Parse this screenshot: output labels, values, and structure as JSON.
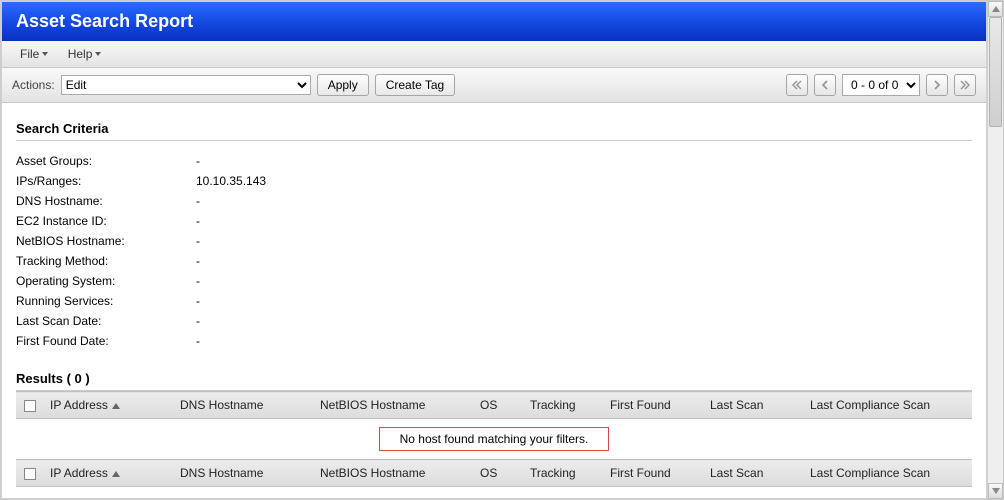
{
  "header": {
    "title": "Asset Search Report"
  },
  "menubar": {
    "file": "File",
    "help": "Help"
  },
  "toolbar": {
    "actions_label": "Actions:",
    "actions_value": "Edit",
    "apply_label": "Apply",
    "create_tag_label": "Create Tag",
    "pager_value": "0 - 0 of 0"
  },
  "criteria": {
    "title": "Search Criteria",
    "rows": [
      {
        "k": "Asset Groups:",
        "v": "-"
      },
      {
        "k": "IPs/Ranges:",
        "v": "10.10.35.143"
      },
      {
        "k": "DNS Hostname:",
        "v": "-"
      },
      {
        "k": "EC2 Instance ID:",
        "v": "-"
      },
      {
        "k": "NetBIOS Hostname:",
        "v": "-"
      },
      {
        "k": "Tracking Method:",
        "v": "-"
      },
      {
        "k": "Operating System:",
        "v": "-"
      },
      {
        "k": "Running Services:",
        "v": "-"
      },
      {
        "k": "Last Scan Date:",
        "v": "-"
      },
      {
        "k": "First Found Date:",
        "v": "-"
      }
    ]
  },
  "results": {
    "title": "Results ( 0 )",
    "cols": {
      "ip": "IP Address",
      "dns": "DNS Hostname",
      "netbios": "NetBIOS Hostname",
      "os": "OS",
      "tracking": "Tracking",
      "first_found": "First Found",
      "last_scan": "Last Scan",
      "last_compliance": "Last Compliance Scan"
    },
    "empty_msg": "No host found matching your filters."
  }
}
